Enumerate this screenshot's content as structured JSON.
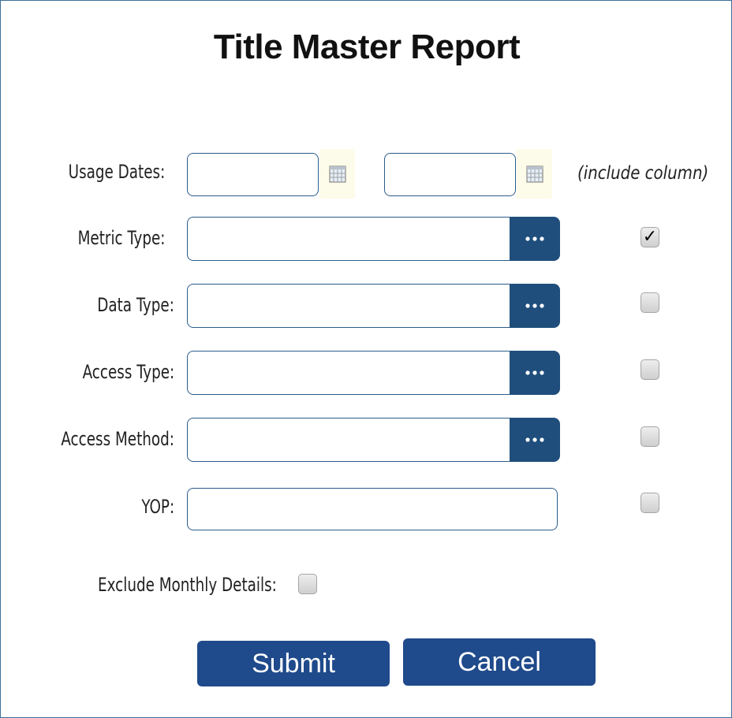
{
  "title": "Title Master Report",
  "include_column_label": "(include column)",
  "fields": {
    "usage_dates": {
      "label": "Usage Dates:",
      "start_value": "",
      "end_value": ""
    },
    "metric_type": {
      "label": "Metric Type:",
      "value": "",
      "include_checked": true
    },
    "data_type": {
      "label": "Data Type:",
      "value": "",
      "include_checked": false
    },
    "access_type": {
      "label": "Access Type:",
      "value": "",
      "include_checked": false
    },
    "access_method": {
      "label": "Access Method:",
      "value": "",
      "include_checked": false
    },
    "yop": {
      "label": "YOP:",
      "value": "",
      "include_checked": false
    }
  },
  "exclude_monthly": {
    "label": "Exclude Monthly Details:",
    "checked": false
  },
  "buttons": {
    "submit": "Submit",
    "cancel": "Cancel"
  },
  "check_mark": "✓",
  "icons": {
    "calendar": "calendar-icon",
    "more": "ellipsis-icon"
  },
  "colors": {
    "accent": "#1f4a8b",
    "field_border": "#2c5c8a",
    "frame_border": "#3d6f97"
  }
}
